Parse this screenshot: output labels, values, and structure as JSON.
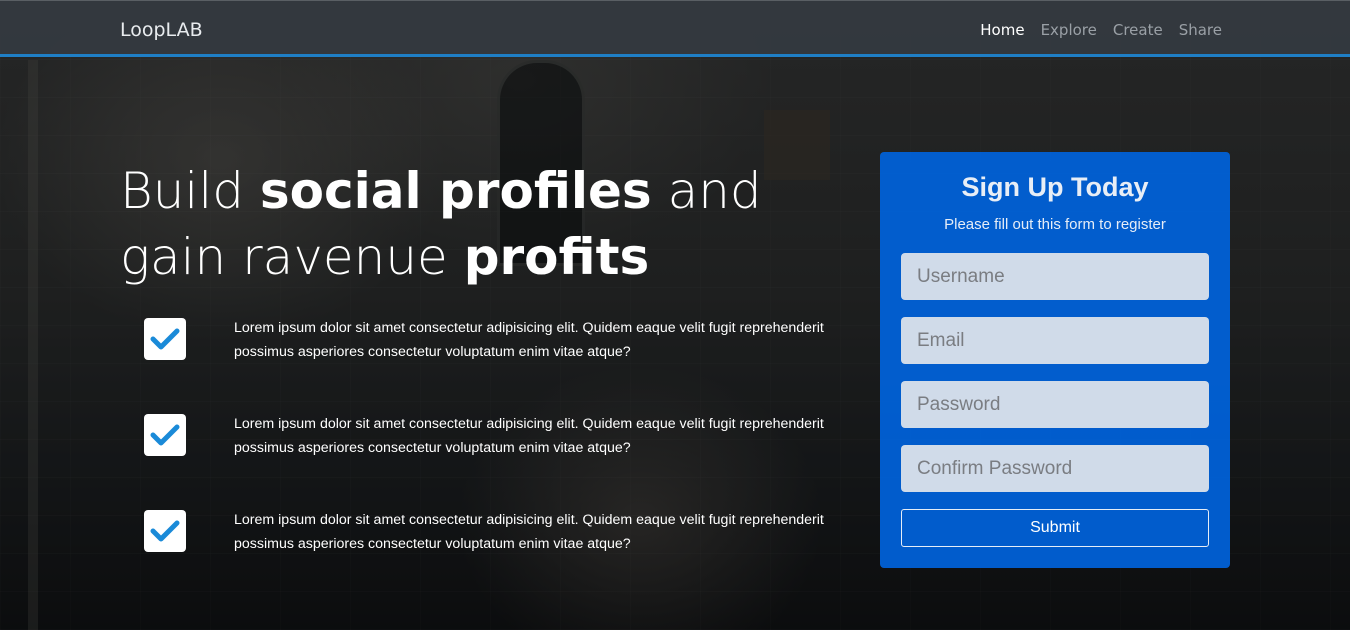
{
  "navbar": {
    "brand": "LoopLAB",
    "links": [
      {
        "label": "Home",
        "active": true
      },
      {
        "label": "Explore",
        "active": false
      },
      {
        "label": "Create",
        "active": false
      },
      {
        "label": "Share",
        "active": false
      }
    ]
  },
  "hero": {
    "headline": {
      "part1": "Build ",
      "bold1": "social profiles",
      "part2": " and gain ravenue ",
      "bold2": "profits"
    },
    "features": [
      {
        "icon": "check-icon",
        "text": "Lorem ipsum dolor sit amet consectetur adipisicing elit. Quidem eaque velit fugit reprehenderit possimus asperiores consectetur voluptatum enim vitae atque?"
      },
      {
        "icon": "check-icon",
        "text": "Lorem ipsum dolor sit amet consectetur adipisicing elit. Quidem eaque velit fugit reprehenderit possimus asperiores consectetur voluptatum enim vitae atque?"
      },
      {
        "icon": "check-icon",
        "text": "Lorem ipsum dolor sit amet consectetur adipisicing elit. Quidem eaque velit fugit reprehenderit possimus asperiores consectetur voluptatum enim vitae atque?"
      }
    ]
  },
  "signup": {
    "title": "Sign Up Today",
    "subtitle": "Please fill out this form to register",
    "username_placeholder": "Username",
    "email_placeholder": "Email",
    "password_placeholder": "Password",
    "confirm_placeholder": "Confirm Password",
    "submit_label": "Submit"
  },
  "colors": {
    "accent": "#1f7fc6",
    "card": "#0063dc",
    "check": "#1a8ad8"
  }
}
